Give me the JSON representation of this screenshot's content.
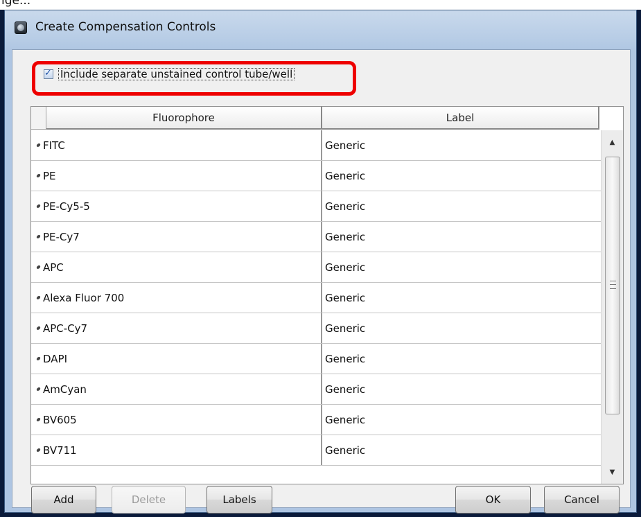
{
  "top_caption": "figure page fragment above dialog",
  "window": {
    "title": "Create Compensation Controls"
  },
  "checkbox": {
    "label": "Include separate unstained control tube/well",
    "checked": true
  },
  "table": {
    "columns": [
      "Fluorophore",
      "Label"
    ],
    "rows": [
      {
        "fluorophore": "FITC",
        "label": "Generic"
      },
      {
        "fluorophore": "PE",
        "label": "Generic"
      },
      {
        "fluorophore": "PE-Cy5-5",
        "label": "Generic"
      },
      {
        "fluorophore": "PE-Cy7",
        "label": "Generic"
      },
      {
        "fluorophore": "APC",
        "label": "Generic"
      },
      {
        "fluorophore": "Alexa Fluor 700",
        "label": "Generic"
      },
      {
        "fluorophore": "APC-Cy7",
        "label": "Generic"
      },
      {
        "fluorophore": "DAPI",
        "label": "Generic"
      },
      {
        "fluorophore": "AmCyan",
        "label": "Generic"
      },
      {
        "fluorophore": "BV605",
        "label": "Generic"
      },
      {
        "fluorophore": "BV711",
        "label": "Generic"
      }
    ]
  },
  "buttons": {
    "add": "Add",
    "delete": "Delete",
    "labels": "Labels",
    "ok": "OK",
    "cancel": "Cancel"
  },
  "icons": {
    "app": "app-icon",
    "scroll_up": "scroll-up-arrow-icon",
    "scroll_down": "scroll-down-arrow-icon"
  },
  "colors": {
    "highlight": "#ee0000",
    "title_bar": "#b8cde6"
  }
}
